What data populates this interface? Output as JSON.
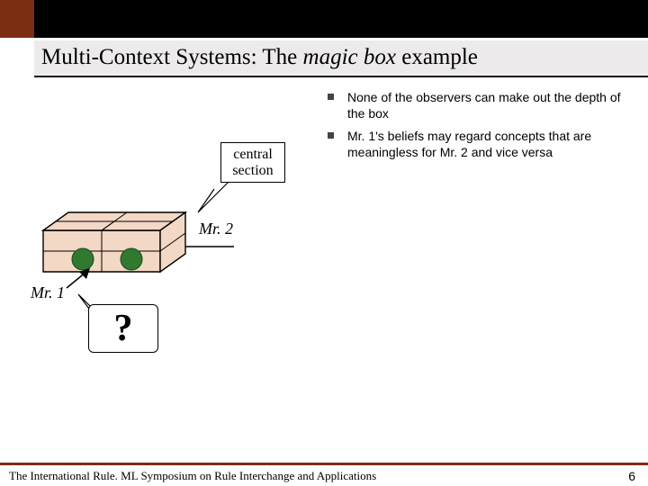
{
  "title": {
    "part1": "Multi-Context Systems: The ",
    "italic": "magic box",
    "part2": " example"
  },
  "bullets": [
    "None of the observers can make out the depth of the box",
    "Mr. 1's  beliefs may regard concepts that are meaningless for Mr. 2 and vice versa"
  ],
  "central_label_line1": "central",
  "central_label_line2": "section",
  "mr2_label": "Mr. 2",
  "mr1_label": "Mr. 1",
  "question_mark": "?",
  "footer_text": "The International Rule. ML Symposium on Rule Interchange and Applications",
  "page_number": "6",
  "colors": {
    "accent": "#7c2e12",
    "box_fill": "#f3d8c5",
    "ball": "#2f7a2f"
  }
}
